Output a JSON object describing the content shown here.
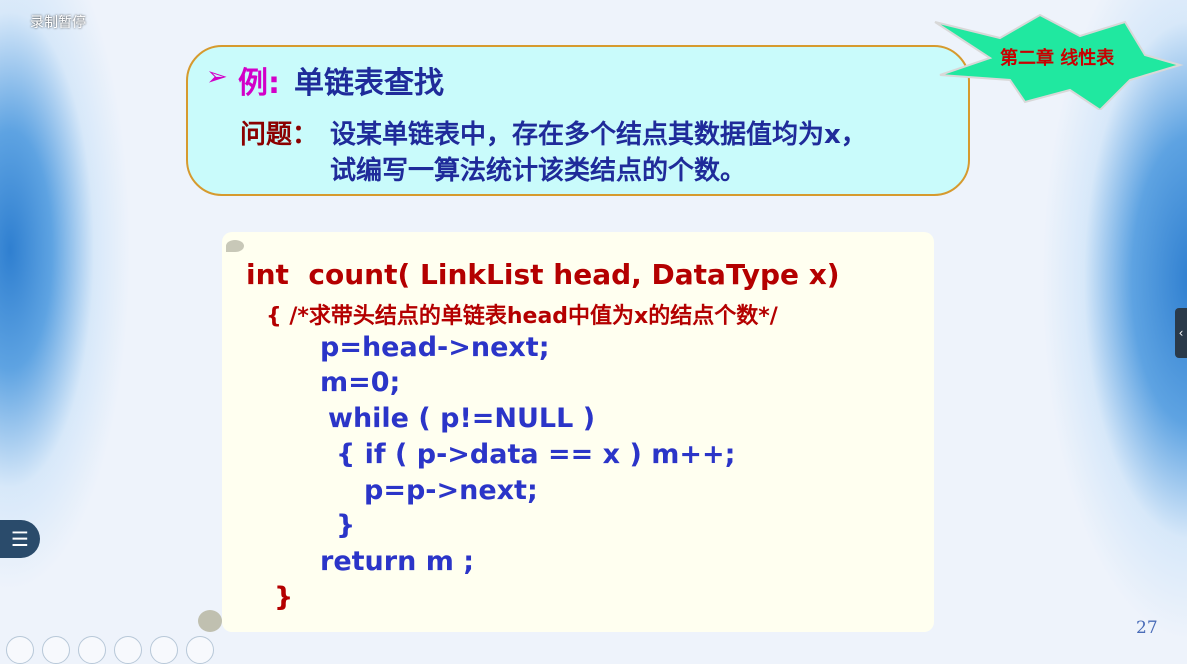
{
  "overlay": {
    "recording_label": "录制暂停"
  },
  "slide": {
    "example_arrow": "➢",
    "example_label": "例:",
    "example_title": "单链表查找",
    "question_label": "问题：",
    "question_line1": "设某单链表中，存在多个结点其数据值均为x，",
    "question_line2": "试编写一算法统计该类结点的个数。",
    "chapter_badge": "第二章 线性表",
    "code": [
      "int  count( LinkList head, DataType x)",
      "{ /*求带头结点的单链表head中值为x的结点个数*/",
      "p=head->next;",
      "m=0;",
      "while ( p!=NULL )",
      "{ if ( p->data == x ) m++;",
      "p=p->next;",
      "}",
      "return m ;",
      "}"
    ],
    "page_number": "27"
  },
  "controls": {
    "menu_icon": "list-icon",
    "side_tab_icon": "chevron-left-icon"
  },
  "colors": {
    "code_red": "#b40000",
    "code_blue": "#2b35c8",
    "title_blue": "#1f2b9a",
    "accent_magenta": "#d200c8",
    "badge_green": "#20e8a0"
  }
}
